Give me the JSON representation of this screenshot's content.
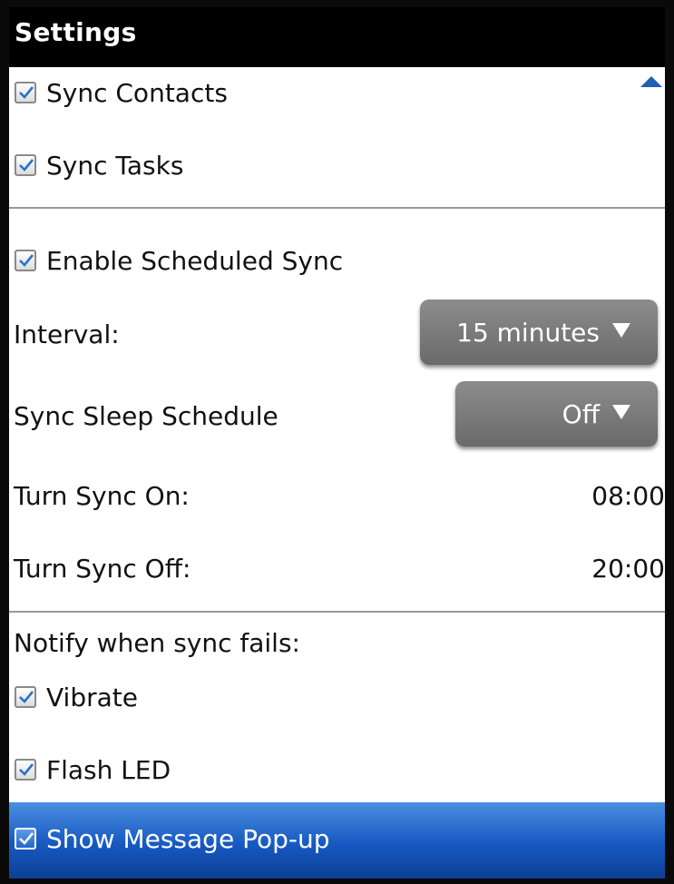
{
  "header": {
    "title": "Settings"
  },
  "sync_items": [
    {
      "label": "Sync Contacts",
      "checked": true
    },
    {
      "label": "Sync Tasks",
      "checked": true
    }
  ],
  "schedule": {
    "enable_label": "Enable Scheduled Sync",
    "enable_checked": true,
    "interval_label": "Interval:",
    "interval_value": "15 minutes",
    "sleep_label": "Sync Sleep Schedule",
    "sleep_value": "Off",
    "turn_on_label": "Turn Sync On:",
    "turn_on_value": "08:00",
    "turn_off_label": "Turn Sync Off:",
    "turn_off_value": "20:00"
  },
  "notify": {
    "header": "Notify when sync fails:",
    "items": [
      {
        "label": "Vibrate",
        "checked": true
      },
      {
        "label": "Flash LED",
        "checked": true
      },
      {
        "label": "Show Message Pop-up",
        "checked": true,
        "selected": true
      }
    ]
  },
  "colors": {
    "titlebar": "#000000",
    "selection": "#1759c2",
    "dropdown": "#7a7a7a",
    "checkmark": "#2a6fd0"
  },
  "icons": {
    "scroll": "scroll-up-arrow-icon",
    "checkbox": "checkmark-icon",
    "dropdown": "dropdown-triangle-icon"
  }
}
